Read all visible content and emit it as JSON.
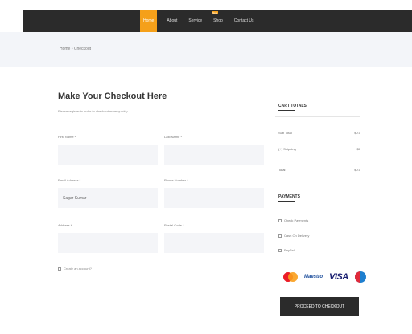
{
  "nav": {
    "items": [
      {
        "label": "Home"
      },
      {
        "label": "About"
      },
      {
        "label": "Service"
      },
      {
        "label": "Shop"
      },
      {
        "label": "Contact Us"
      }
    ],
    "shop_badge": "New"
  },
  "breadcrumb": "Home  •  Checkout",
  "form": {
    "title": "Make Your Checkout Here",
    "subtitle": "Please register in order to checkout more quickly",
    "fields": [
      {
        "label": "First Name *",
        "value": "T"
      },
      {
        "label": "Last Name *",
        "value": ""
      },
      {
        "label": "Email Address *",
        "value": "Sagar Kumar"
      },
      {
        "label": "Phone Number *",
        "value": ""
      },
      {
        "label": "Address *",
        "value": ""
      },
      {
        "label": "Postal Code *",
        "value": ""
      }
    ],
    "create_account": "Create an account?"
  },
  "cart": {
    "title": "CART TOTALS",
    "rows": [
      {
        "label": "Sub Total",
        "value": "$0.0"
      },
      {
        "label": "(+) Shipping",
        "value": "$0"
      },
      {
        "label": "Total",
        "value": "$0.0"
      }
    ]
  },
  "payments": {
    "title": "PAYMENTS",
    "options": [
      "Check Payments",
      "Cash On Delivery",
      "PayPal"
    ],
    "card_logos": [
      "mastercard-logo",
      "maestro-logo",
      "visa-logo",
      "amex-logo"
    ],
    "maestro_text": "Maestro",
    "visa_text": "VISA"
  },
  "proceed_label": "PROCEED TO CHECKOUT",
  "colors": {
    "accent": "#f5a01a",
    "nav_bg": "#2b2b2b",
    "page_bg": "#f3f5f9"
  }
}
